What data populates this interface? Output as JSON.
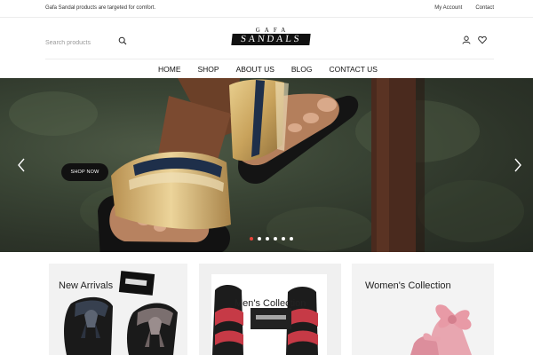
{
  "topbar": {
    "note": "Gafa Sandal products are targeted for comfort.",
    "links": [
      "My Account",
      "Contact"
    ]
  },
  "header": {
    "search_placeholder": "Search products",
    "logo": {
      "top": "GAFA",
      "bottom": "SANDALS"
    },
    "icons": [
      "user-icon",
      "heart-icon"
    ]
  },
  "nav": {
    "items": [
      "HOME",
      "SHOP",
      "ABOUT US",
      "BLOG",
      "CONTACT US"
    ]
  },
  "hero": {
    "button_label": "SHOP NOW",
    "slides": 6,
    "active_slide": 1,
    "colors": {
      "active_dot": "#e8443a",
      "dot": "#ffffff",
      "button": "#111111"
    }
  },
  "collections": [
    {
      "title": "New Arrivals"
    },
    {
      "title": "Men's Collection"
    },
    {
      "title": "Women's Collection"
    }
  ]
}
